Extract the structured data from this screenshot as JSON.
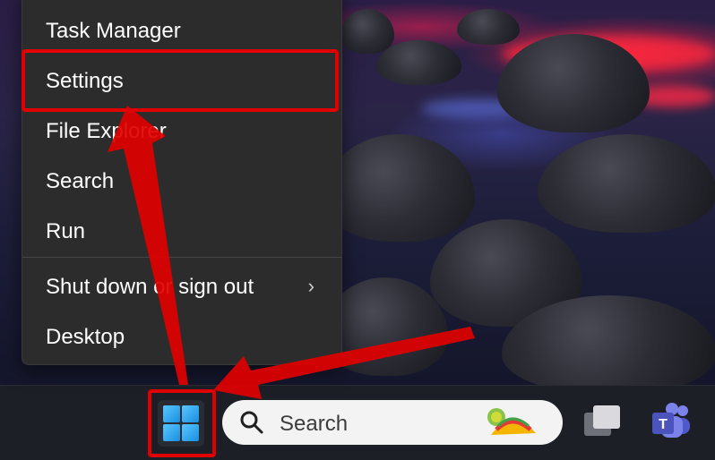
{
  "context_menu": {
    "items": [
      {
        "label": "Task Manager"
      },
      {
        "label": "Settings"
      },
      {
        "label": "File Explorer"
      },
      {
        "label": "Search"
      },
      {
        "label": "Run"
      },
      {
        "label": "Shut down or sign out",
        "has_submenu": true
      },
      {
        "label": "Desktop"
      }
    ],
    "submenu_chevron": "›"
  },
  "taskbar": {
    "search_placeholder": "Search",
    "start_button": "windows-logo-icon",
    "task_view": "task-view-icon",
    "teams": "teams-icon"
  },
  "annotations": {
    "highlight_color": "#e00000"
  }
}
